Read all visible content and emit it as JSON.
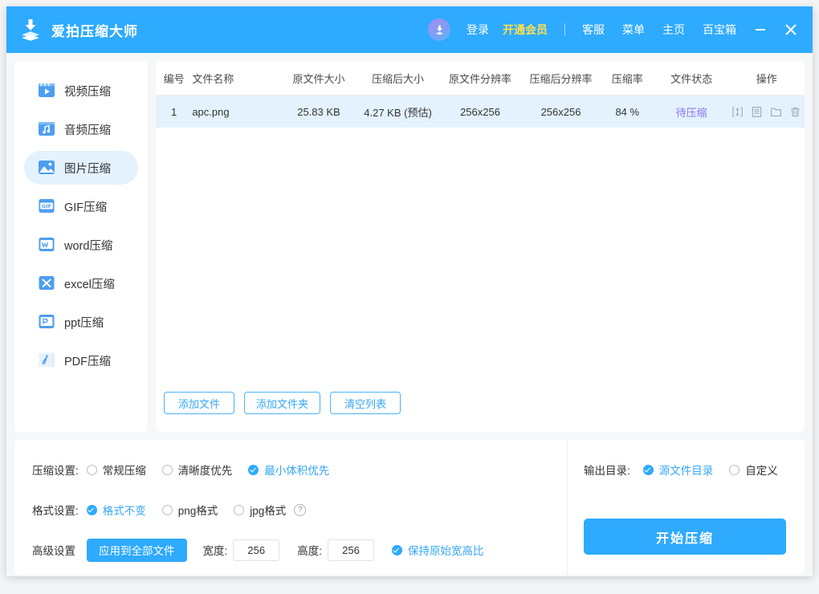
{
  "app": {
    "title": "爱拍压缩大师",
    "logo_icon": "download-stack-icon"
  },
  "titlebar": {
    "avatar_icon": "user-avatar-icon",
    "login": "登录",
    "vip": "开通会员",
    "support": "客服",
    "menu": "菜单",
    "home": "主页",
    "toolbox": "百宝箱",
    "minimize_icon": "minimize-icon",
    "close_icon": "close-icon",
    "bg_color": "#2eaaff",
    "vip_color": "#ffe14d"
  },
  "sidebar": {
    "items": [
      {
        "label": "视频压缩",
        "icon": "video-compress-icon",
        "active": false
      },
      {
        "label": "音频压缩",
        "icon": "audio-compress-icon",
        "active": false
      },
      {
        "label": "图片压缩",
        "icon": "image-compress-icon",
        "active": true
      },
      {
        "label": "GIF压缩",
        "icon": "gif-compress-icon",
        "active": false
      },
      {
        "label": "word压缩",
        "icon": "word-compress-icon",
        "active": false
      },
      {
        "label": "excel压缩",
        "icon": "excel-compress-icon",
        "active": false
      },
      {
        "label": "ppt压缩",
        "icon": "ppt-compress-icon",
        "active": false
      },
      {
        "label": "PDF压缩",
        "icon": "pdf-compress-icon",
        "active": false
      }
    ],
    "active_bg": "#e3f2fd"
  },
  "table": {
    "columns": [
      "编号",
      "文件名称",
      "原文件大小",
      "压缩后大小",
      "原文件分辨率",
      "压缩后分辨率",
      "压缩率",
      "文件状态",
      "操作"
    ],
    "rows": [
      {
        "no": "1",
        "name": "apc.png",
        "orig_size": "25.83 KB",
        "compressed_size": "4.27 KB (预估)",
        "orig_resolution": "256x256",
        "compressed_resolution": "256x256",
        "ratio": "84 %",
        "status": "待压缩",
        "status_color": "#8a74ee",
        "ops": [
          "resize-icon",
          "preview-icon",
          "open-folder-icon",
          "delete-icon"
        ]
      }
    ],
    "row_bg": "#e3f2fd"
  },
  "list_actions": {
    "add_file": "添加文件",
    "add_folder": "添加文件夹",
    "clear_list": "清空列表"
  },
  "settings": {
    "compress": {
      "label": "压缩设置:",
      "options": [
        {
          "label": "常规压缩",
          "selected": false
        },
        {
          "label": "清晰度优先",
          "selected": false
        },
        {
          "label": "最小体积优先",
          "selected": true
        }
      ]
    },
    "format": {
      "label": "格式设置:",
      "options": [
        {
          "label": "格式不变",
          "selected": true
        },
        {
          "label": "png格式",
          "selected": false
        },
        {
          "label": "jpg格式",
          "selected": false
        }
      ],
      "help_icon": "help-question-icon"
    },
    "advanced": {
      "label": "高级设置",
      "apply_all": "应用到全部文件",
      "width_label": "宽度:",
      "width_value": "256",
      "height_label": "高度:",
      "height_value": "256",
      "keep_ratio": {
        "label": "保持原始宽高比",
        "selected": true
      }
    },
    "output": {
      "label": "输出目录:",
      "options": [
        {
          "label": "源文件目录",
          "selected": true
        },
        {
          "label": "自定义",
          "selected": false
        }
      ]
    },
    "start_button": "开始压缩",
    "accent_color": "#2eaaff"
  }
}
